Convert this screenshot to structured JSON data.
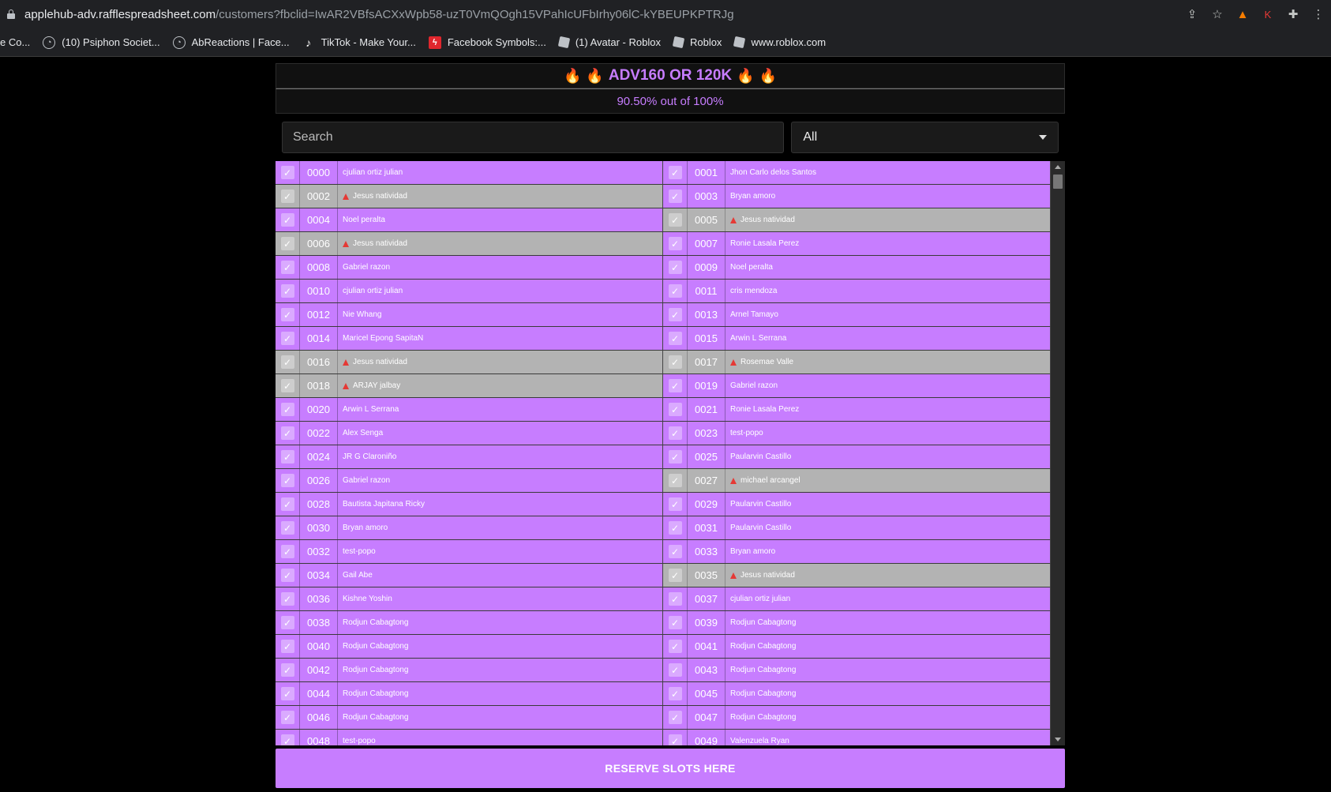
{
  "browser": {
    "url_host": "applehub-adv.rafflespreadsheet.com",
    "url_path": "/customers?fbclid=IwAR2VBfsACXxWpb58-uzT0VmQOgh15VPahIcUFbIrhy06lC-kYBEUPKPTRJg",
    "bookmarks": [
      {
        "label": "e Co...",
        "icon": "none"
      },
      {
        "label": "(10) Psiphon Societ...",
        "icon": "globe-icon"
      },
      {
        "label": "AbReactions | Face...",
        "icon": "globe-icon"
      },
      {
        "label": "TikTok - Make Your...",
        "icon": "tiktok-icon"
      },
      {
        "label": "Facebook Symbols:...",
        "icon": "facebook-symbols-icon"
      },
      {
        "label": "(1) Avatar - Roblox",
        "icon": "roblox-icon"
      },
      {
        "label": "Roblox",
        "icon": "roblox-icon"
      },
      {
        "label": "www.roblox.com",
        "icon": "roblox-icon"
      }
    ]
  },
  "header": {
    "title": "ADV160 OR 120K",
    "flame": "🔥",
    "progress": "90.50% out of 100%"
  },
  "filters": {
    "search_placeholder": "Search",
    "status_selected": "All"
  },
  "colors": {
    "open": "#c77dff",
    "pending": "#b3b3b3",
    "warning": "#e53935"
  },
  "slots": [
    {
      "num": "0000",
      "name": "cjulian ortiz julian",
      "status": "open"
    },
    {
      "num": "0001",
      "name": "Jhon Carlo delos Santos",
      "status": "open"
    },
    {
      "num": "0002",
      "name": "Jesus natividad",
      "status": "pending"
    },
    {
      "num": "0003",
      "name": "Bryan amoro",
      "status": "open"
    },
    {
      "num": "0004",
      "name": "Noel peralta",
      "status": "open"
    },
    {
      "num": "0005",
      "name": "Jesus natividad",
      "status": "pending"
    },
    {
      "num": "0006",
      "name": "Jesus natividad",
      "status": "pending"
    },
    {
      "num": "0007",
      "name": "Ronie Lasala Perez",
      "status": "open"
    },
    {
      "num": "0008",
      "name": "Gabriel razon",
      "status": "open"
    },
    {
      "num": "0009",
      "name": "Noel peralta",
      "status": "open"
    },
    {
      "num": "0010",
      "name": "cjulian ortiz julian",
      "status": "open"
    },
    {
      "num": "0011",
      "name": "cris mendoza",
      "status": "open"
    },
    {
      "num": "0012",
      "name": "Nie Whang",
      "status": "open"
    },
    {
      "num": "0013",
      "name": "Arnel Tamayo",
      "status": "open"
    },
    {
      "num": "0014",
      "name": "Maricel Epong SapitaN",
      "status": "open"
    },
    {
      "num": "0015",
      "name": "Arwin L Serrana",
      "status": "open"
    },
    {
      "num": "0016",
      "name": "Jesus natividad",
      "status": "pending"
    },
    {
      "num": "0017",
      "name": "Rosemae Valle",
      "status": "pending"
    },
    {
      "num": "0018",
      "name": "ARJAY jalbay",
      "status": "pending"
    },
    {
      "num": "0019",
      "name": "Gabriel razon",
      "status": "open"
    },
    {
      "num": "0020",
      "name": "Arwin L Serrana",
      "status": "open"
    },
    {
      "num": "0021",
      "name": "Ronie Lasala Perez",
      "status": "open"
    },
    {
      "num": "0022",
      "name": "Alex Senga",
      "status": "open"
    },
    {
      "num": "0023",
      "name": "test-popo",
      "status": "open"
    },
    {
      "num": "0024",
      "name": "JR G Claroniño",
      "status": "open"
    },
    {
      "num": "0025",
      "name": "Paularvin Castillo",
      "status": "open"
    },
    {
      "num": "0026",
      "name": "Gabriel razon",
      "status": "open"
    },
    {
      "num": "0027",
      "name": "michael arcangel",
      "status": "pending"
    },
    {
      "num": "0028",
      "name": "Bautista Japitana Ricky",
      "status": "open"
    },
    {
      "num": "0029",
      "name": "Paularvin Castillo",
      "status": "open"
    },
    {
      "num": "0030",
      "name": "Bryan amoro",
      "status": "open"
    },
    {
      "num": "0031",
      "name": "Paularvin Castillo",
      "status": "open"
    },
    {
      "num": "0032",
      "name": "test-popo",
      "status": "open"
    },
    {
      "num": "0033",
      "name": "Bryan amoro",
      "status": "open"
    },
    {
      "num": "0034",
      "name": "Gail Abe",
      "status": "open"
    },
    {
      "num": "0035",
      "name": "Jesus natividad",
      "status": "pending"
    },
    {
      "num": "0036",
      "name": "Kishne Yoshin",
      "status": "open"
    },
    {
      "num": "0037",
      "name": "cjulian ortiz julian",
      "status": "open"
    },
    {
      "num": "0038",
      "name": "Rodjun Cabagtong",
      "status": "open"
    },
    {
      "num": "0039",
      "name": "Rodjun Cabagtong",
      "status": "open"
    },
    {
      "num": "0040",
      "name": "Rodjun Cabagtong",
      "status": "open"
    },
    {
      "num": "0041",
      "name": "Rodjun Cabagtong",
      "status": "open"
    },
    {
      "num": "0042",
      "name": "Rodjun Cabagtong",
      "status": "open"
    },
    {
      "num": "0043",
      "name": "Rodjun Cabagtong",
      "status": "open"
    },
    {
      "num": "0044",
      "name": "Rodjun Cabagtong",
      "status": "open"
    },
    {
      "num": "0045",
      "name": "Rodjun Cabagtong",
      "status": "open"
    },
    {
      "num": "0046",
      "name": "Rodjun Cabagtong",
      "status": "open"
    },
    {
      "num": "0047",
      "name": "Rodjun Cabagtong",
      "status": "open"
    },
    {
      "num": "0048",
      "name": "test-popo",
      "status": "open"
    },
    {
      "num": "0049",
      "name": "Valenzuela Ryan",
      "status": "open"
    }
  ],
  "reserve_label": "RESERVE SLOTS HERE"
}
